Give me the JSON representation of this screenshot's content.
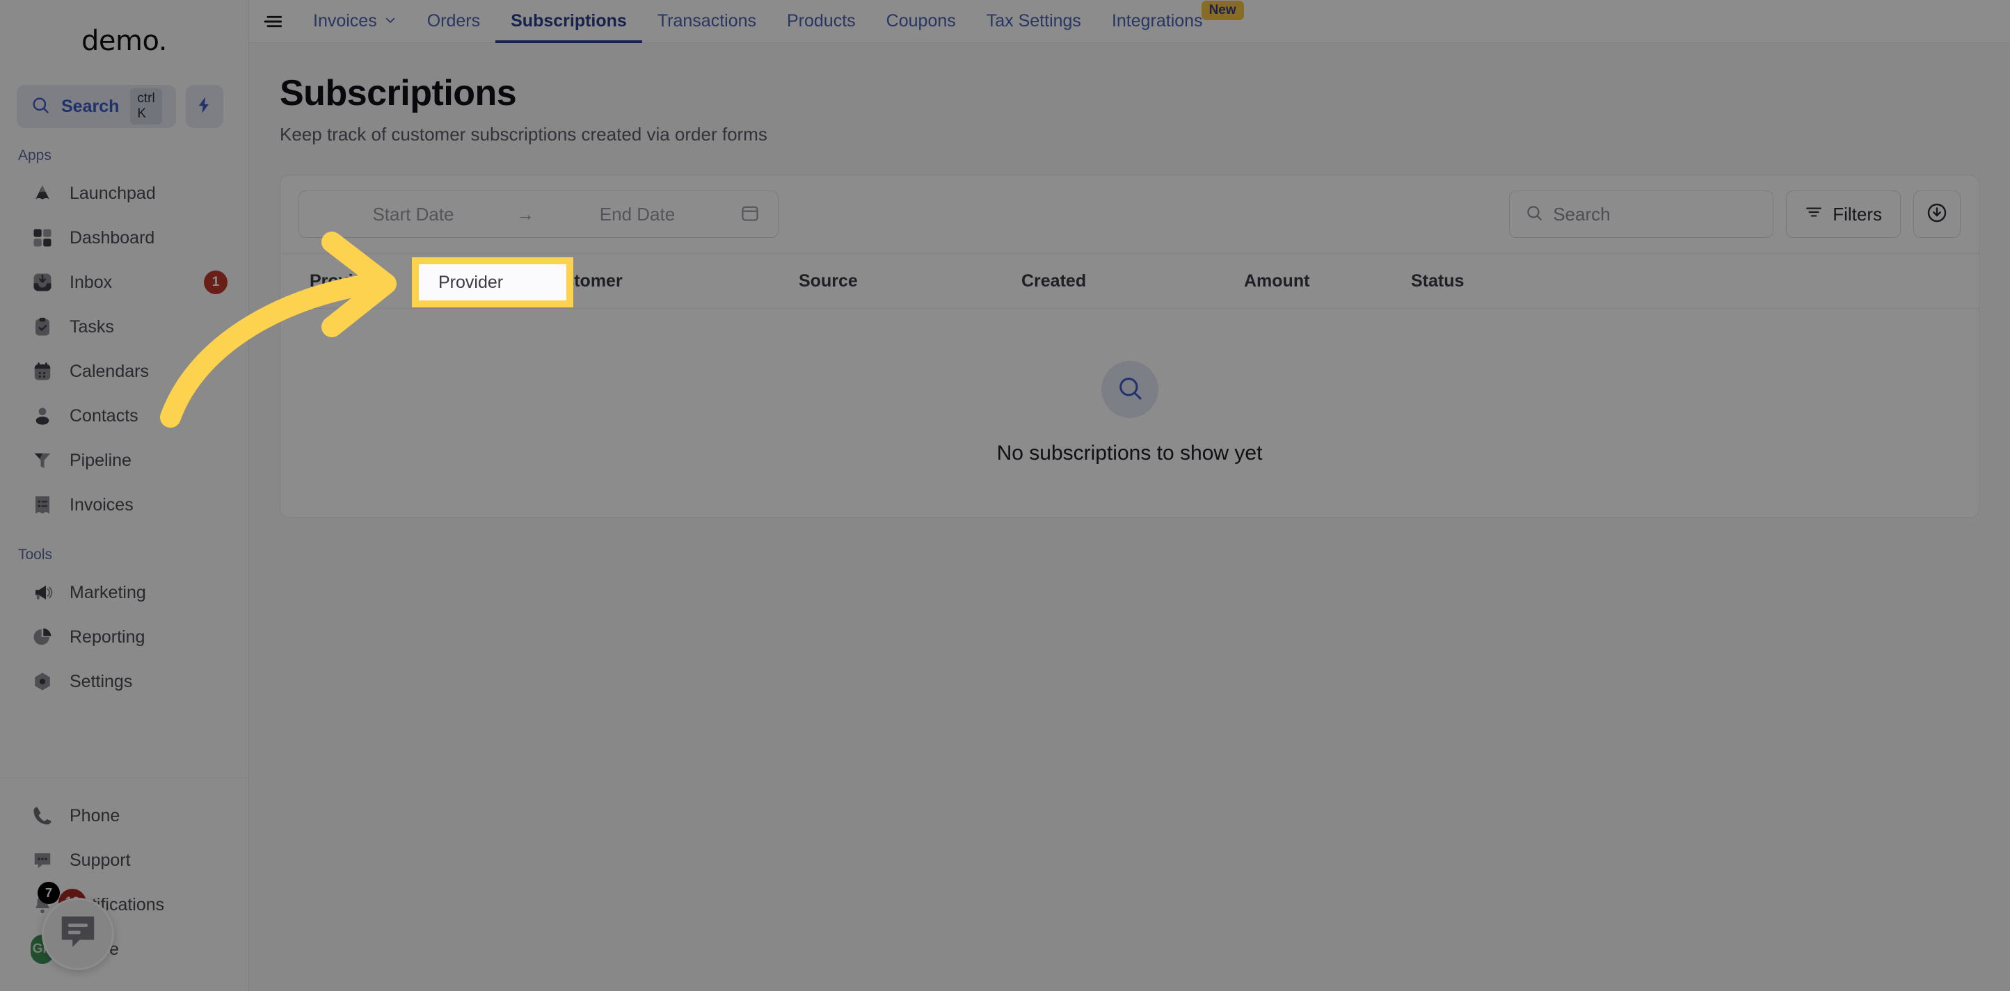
{
  "sidebar": {
    "brand": "demo",
    "brand_dot": ".",
    "search": {
      "label": "Search",
      "shortcut": "ctrl K",
      "icon": "search-icon"
    },
    "bolt_icon": "lightning-bolt-icon",
    "sections": [
      {
        "label": "Apps",
        "items": [
          {
            "label": "Launchpad",
            "icon": "launchpad-icon",
            "badge": ""
          },
          {
            "label": "Dashboard",
            "icon": "dashboard-grid-icon",
            "badge": ""
          },
          {
            "label": "Inbox",
            "icon": "inbox-icon",
            "badge": "1"
          },
          {
            "label": "Tasks",
            "icon": "clipboard-check-icon",
            "badge": ""
          },
          {
            "label": "Calendars",
            "icon": "calendar-icon",
            "badge": ""
          },
          {
            "label": "Contacts",
            "icon": "person-icon",
            "badge": ""
          },
          {
            "label": "Pipeline",
            "icon": "funnel-icon",
            "badge": ""
          },
          {
            "label": "Invoices",
            "icon": "invoice-list-icon",
            "badge": ""
          }
        ]
      },
      {
        "label": "Tools",
        "items": [
          {
            "label": "Marketing",
            "icon": "megaphone-icon",
            "badge": ""
          },
          {
            "label": "Reporting",
            "icon": "pie-chart-icon",
            "badge": ""
          },
          {
            "label": "Settings",
            "icon": "gear-icon",
            "badge": ""
          }
        ]
      }
    ],
    "bottom_items": [
      {
        "label": "Phone",
        "icon": "phone-icon"
      },
      {
        "label": "Support",
        "icon": "chat-dots-icon"
      },
      {
        "label": "Notifications",
        "icon": "bell-icon",
        "badge_black": "7",
        "badge_red": "19"
      },
      {
        "label": "Profile",
        "icon": "avatar-icon",
        "avatar_initials": "GR"
      }
    ],
    "chat_widget_icon": "chat-bubble-icon"
  },
  "topnav": {
    "menu_icon": "hamburger-menu-icon",
    "items": [
      {
        "label": "Invoices",
        "active": false,
        "caret": true,
        "badge": ""
      },
      {
        "label": "Orders",
        "active": false,
        "caret": false,
        "badge": ""
      },
      {
        "label": "Subscriptions",
        "active": true,
        "caret": false,
        "badge": ""
      },
      {
        "label": "Transactions",
        "active": false,
        "caret": false,
        "badge": ""
      },
      {
        "label": "Products",
        "active": false,
        "caret": false,
        "badge": ""
      },
      {
        "label": "Coupons",
        "active": false,
        "caret": false,
        "badge": ""
      },
      {
        "label": "Tax Settings",
        "active": false,
        "caret": false,
        "badge": ""
      },
      {
        "label": "Integrations",
        "active": false,
        "caret": false,
        "badge": "New"
      }
    ]
  },
  "page": {
    "title": "Subscriptions",
    "subtitle": "Keep track of customer subscriptions created via order forms"
  },
  "toolbar": {
    "start_date_placeholder": "Start Date",
    "range_arrow": "→",
    "end_date_placeholder": "End Date",
    "calendar_icon": "calendar-icon",
    "search_placeholder": "Search",
    "search_icon": "search-icon",
    "filters_label": "Filters",
    "filters_icon": "filter-lines-icon",
    "download_icon": "download-circle-icon"
  },
  "table": {
    "columns": [
      "Provider",
      "Customer",
      "Source",
      "Created",
      "Amount",
      "Status"
    ],
    "rows": [],
    "empty_state": {
      "icon": "search-icon",
      "text": "No subscriptions to show yet"
    }
  },
  "annotation": {
    "highlight_label": "Provider",
    "highlight_color": "#fdd24f",
    "arrow_color": "#fdd24f"
  }
}
